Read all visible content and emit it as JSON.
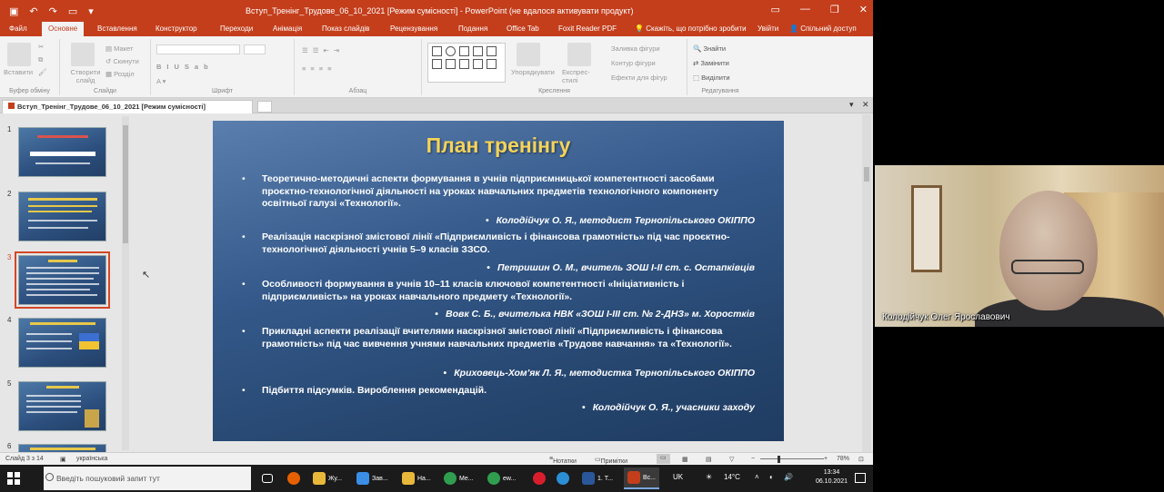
{
  "window": {
    "title": "Вступ_Тренінг_Трудове_06_10_2021 [Режим сумісності] - PowerPoint (не вдалося активувати продукт)",
    "accent": "#c43e1c"
  },
  "ribbon_tabs": [
    "Файл",
    "Основне",
    "Вставлення",
    "Конструктор",
    "Переходи",
    "Анімація",
    "Показ слайдів",
    "Рецензування",
    "Подання",
    "Office Tab",
    "Foxit Reader PDF"
  ],
  "ribbon_tabs_right": {
    "tell_me": "Скажіть, що потрібно зробити",
    "sign_in": "Увійти",
    "share": "Спільний доступ"
  },
  "ribbon": {
    "paste": "Вставити",
    "new_slide": "Створити слайд",
    "layout": "Макет",
    "reset": "Скинути",
    "section": "Розділ",
    "arrange": "Упорядкувати",
    "quick_styles": "Експрес-стилі",
    "shape_fill": "Заливка фігури",
    "shape_outline": "Контур фігури",
    "shape_effects": "Ефекти для фігур",
    "find": "Знайти",
    "replace": "Замінити",
    "select": "Виділити",
    "groups": [
      "Буфер обміну",
      "Слайди",
      "Шрифт",
      "Абзац",
      "Креслення",
      "Редагування"
    ]
  },
  "doc_tab": "Вступ_Тренінг_Трудове_06_10_2021 [Режим сумісності]",
  "thumbnails": [
    "1",
    "2",
    "3",
    "4",
    "5",
    "6"
  ],
  "selected_slide": 3,
  "slide": {
    "title": "План тренінгу",
    "items": [
      {
        "text": "Теоретично-методичні аспекти формування в учнів підприємницької компетентності засобами проєктно-технологічної діяльності на уроках навчальних предметів технологічного компоненту освітньої галузі «Технології».",
        "author": "Колодійчук О. Я., методист Тернопільського ОКІППО"
      },
      {
        "text": "Реалізація наскрізної змістової лінії «Підприємливість і фінансова грамотність» під час проєктно-технологічної діяльності учнів 5–9 класів ЗЗСО.",
        "author": "Петришин О. М., вчитель ЗОШ І-ІІ ст. с. Остапківців"
      },
      {
        "text": "Особливості формування в учнів 10–11 класів ключової компетентності «Ініціативність і підприємливість» на уроках навчального предмету «Технології».",
        "author": "Вовк С. Б., вчителька НВК «ЗОШ І-ІІІ ст. № 2-ДНЗ» м. Хоростків"
      },
      {
        "text": "Прикладні аспекти реалізації вчителями наскрізної змістової лінії «Підприємливість і фінансова грамотність» під час вивчення учнями навчальних предметів «Трудове навчання» та «Технології».",
        "author": "Криховець-Хом'як Л. Я., методистка Тернопільського ОКІППО"
      },
      {
        "text": "Підбиття підсумків. Вироблення рекомендацій.",
        "author": "Колодійчук О. Я., учасники заходу"
      }
    ]
  },
  "statusbar": {
    "slide_counter": "Слайд 3 з 14",
    "language": "українська",
    "notes": "Нотатки",
    "comments": "Примітки",
    "zoom": "78%"
  },
  "webcam": {
    "name": "Колодійчук Олег Ярославович"
  },
  "taskbar": {
    "search_placeholder": "Введіть пошуковий запит тут",
    "apps": [
      {
        "label": "",
        "icon": "firefox-icon",
        "color": "#e66000"
      },
      {
        "label": "Жу...",
        "icon": "folder-icon",
        "color": "#e8b83a"
      },
      {
        "label": "Зав...",
        "icon": "download-icon",
        "color": "#3a8ee6"
      },
      {
        "label": "На...",
        "icon": "folder-icon",
        "color": "#e8b83a"
      },
      {
        "label": "Ме...",
        "icon": "chrome-icon",
        "color": "#2f9e4f"
      },
      {
        "label": "ew...",
        "icon": "chrome-icon",
        "color": "#2f9e4f"
      },
      {
        "label": "",
        "icon": "opera-icon",
        "color": "#d81e2c"
      },
      {
        "label": "",
        "icon": "edge-icon",
        "color": "#2b8fd6"
      },
      {
        "label": "1. Т...",
        "icon": "word-icon",
        "color": "#2b579a"
      },
      {
        "label": "Вс...",
        "icon": "powerpoint-icon",
        "color": "#c43e1c"
      }
    ],
    "lang": "UK",
    "temperature": "14°C",
    "time": "13:34",
    "date": "06.10.2021"
  }
}
